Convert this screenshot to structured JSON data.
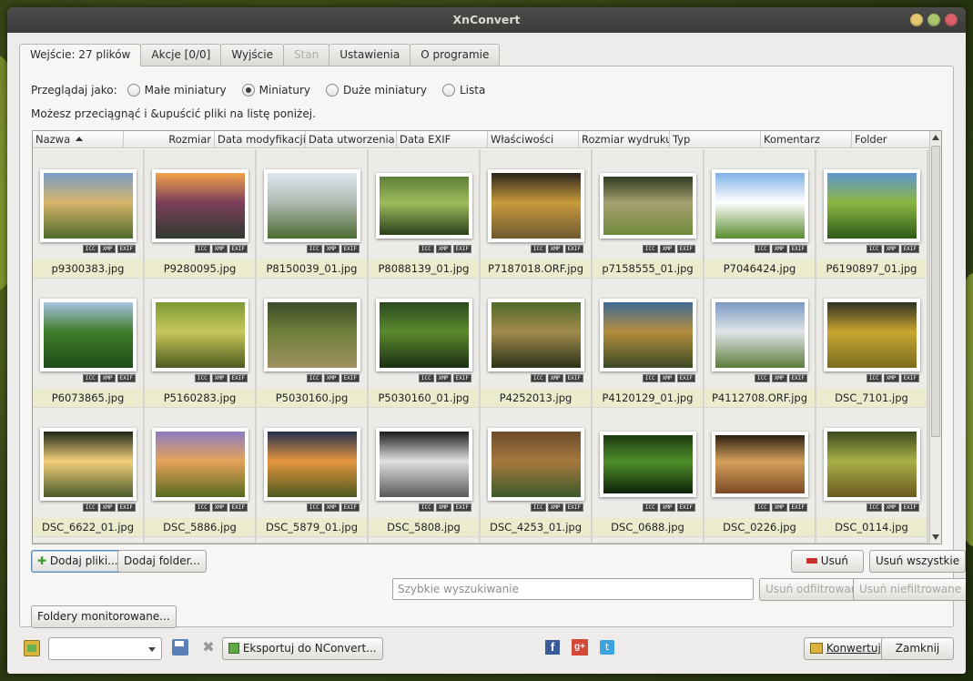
{
  "window": {
    "title": "XnConvert"
  },
  "tabs": [
    {
      "label": "Wejście: 27 plików",
      "active": true
    },
    {
      "label": "Akcje [0/0]"
    },
    {
      "label": "Wyjście"
    },
    {
      "label": "Stan",
      "disabled": true
    },
    {
      "label": "Ustawienia"
    },
    {
      "label": "O programie"
    }
  ],
  "view": {
    "label": "Przeglądaj jako:",
    "options": [
      "Małe miniatury",
      "Miniatury",
      "Duże miniatury",
      "Lista"
    ],
    "selected": "Miniatury"
  },
  "hint": "Możesz przeciągnąć i &upuścić pliki na listę poniżej.",
  "columns": [
    "Nazwa",
    "Rozmiar",
    "Data modyfikacji",
    "Data utworzenia",
    "Data EXIF",
    "Właściwości",
    "Rozmiar wydruku",
    "Typ",
    "Komentarz",
    "Folder"
  ],
  "badges": [
    "ICC",
    "XMP",
    "EXIF"
  ],
  "files": [
    "p9300383.jpg",
    "P9280095.jpg",
    "P8150039_01.jpg",
    "P8088139_01.jpg",
    "P7187018.ORF.jpg",
    "p7158555_01.jpg",
    "P7046424.jpg",
    "P6190897_01.jpg",
    "P6073865.jpg",
    "P5160283.jpg",
    "P5030160.jpg",
    "P5030160_01.jpg",
    "P4252013.jpg",
    "P4120129_01.jpg",
    "P4112708.ORF.jpg",
    "DSC_7101.jpg",
    "DSC_6622_01.jpg",
    "DSC_5886.jpg",
    "DSC_5879_01.jpg",
    "DSC_5808.jpg",
    "DSC_4253_01.jpg",
    "DSC_0688.jpg",
    "DSC_0226.jpg",
    "DSC_0114.jpg"
  ],
  "buttons": {
    "add_files": "Dodaj pliki...",
    "add_folder": "Dodaj folder...",
    "remove": "Usuń",
    "remove_all": "Usuń wszystkie",
    "remove_filtered": "Usuń odfiltrowane",
    "remove_unfiltered": "Usuń niefiltrowane",
    "monitored": "Foldery monitorowane...",
    "export": "Eksportuj do NConvert...",
    "convert": "Konwertuj",
    "close": "Zamknij"
  },
  "search": {
    "placeholder": "Szybkie wyszukiwanie"
  },
  "colors": {
    "accent": "#5b8ab7",
    "name_bar": "#ebebcd"
  }
}
